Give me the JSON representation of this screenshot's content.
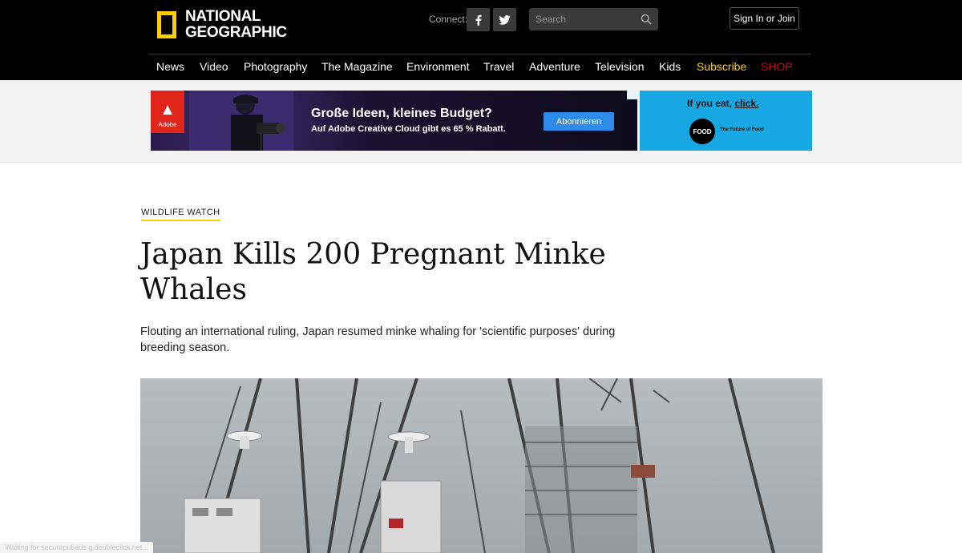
{
  "header": {
    "logo_line1": "NATIONAL",
    "logo_line2": "GEOGRAPHIC",
    "connect_label": "Connect:",
    "search_placeholder": "Search",
    "signin_label": "Sign In or Join",
    "colors": {
      "brand_yellow": "#ffce00",
      "shop_red": "#d0021b",
      "background": "#000000"
    }
  },
  "nav": {
    "items": [
      "News",
      "Video",
      "Photography",
      "The Magazine",
      "Environment",
      "Travel",
      "Adventure",
      "Television",
      "Kids"
    ],
    "subscribe": "Subscribe",
    "shop": "SHOP"
  },
  "ads": {
    "adobe": {
      "brand": "Adobe",
      "headline": "Große Ideen, kleines Budget?",
      "subline": "Auf Adobe Creative Cloud gibt es 65 % Rabatt.",
      "cta": "Abonnieren"
    },
    "food": {
      "line_prefix": "If you eat, ",
      "line_link": "click.",
      "badge": "FOOD",
      "tagline": "The Future of Food"
    }
  },
  "article": {
    "kicker": "WILDLIFE WATCH",
    "title": "Japan Kills 200 Pregnant Minke Whales",
    "dek": "Flouting an international ruling, Japan resumed minke whaling for 'scientific purposes' during breeding season."
  },
  "status_bar": {
    "text": "Waiting for securepubads.g.doubleclick.net..."
  }
}
